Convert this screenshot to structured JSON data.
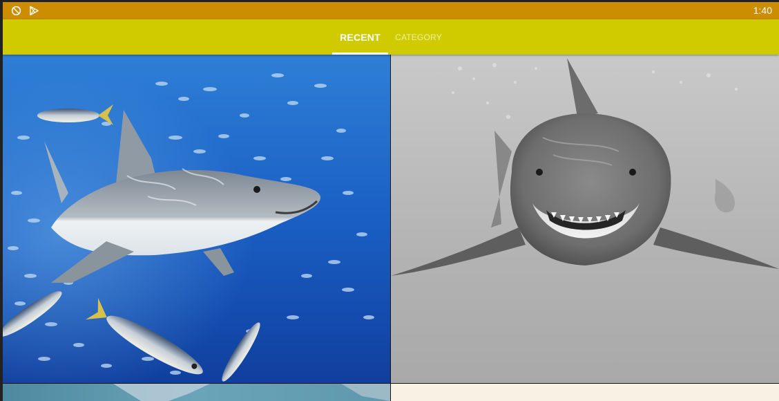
{
  "status_bar": {
    "time": "1:40",
    "icons": [
      "sync-disabled-icon",
      "play-store-icon"
    ]
  },
  "tabs": [
    {
      "label": "RECENT",
      "selected": true
    },
    {
      "label": "CATEGORY",
      "selected": false
    }
  ],
  "colors": {
    "status_bar": "#cc8e00",
    "app_bar": "#d0cb00",
    "tab_selected": "#ffffff",
    "tab_unselected": "#f2ef9c"
  },
  "gallery": [
    {
      "image": "great-white-shark-blue-water-with-fish"
    },
    {
      "image": "great-white-shark-front-view-grayscale"
    },
    {
      "image": "shark-partial-teal"
    },
    {
      "image": "light-cream-partial"
    }
  ]
}
